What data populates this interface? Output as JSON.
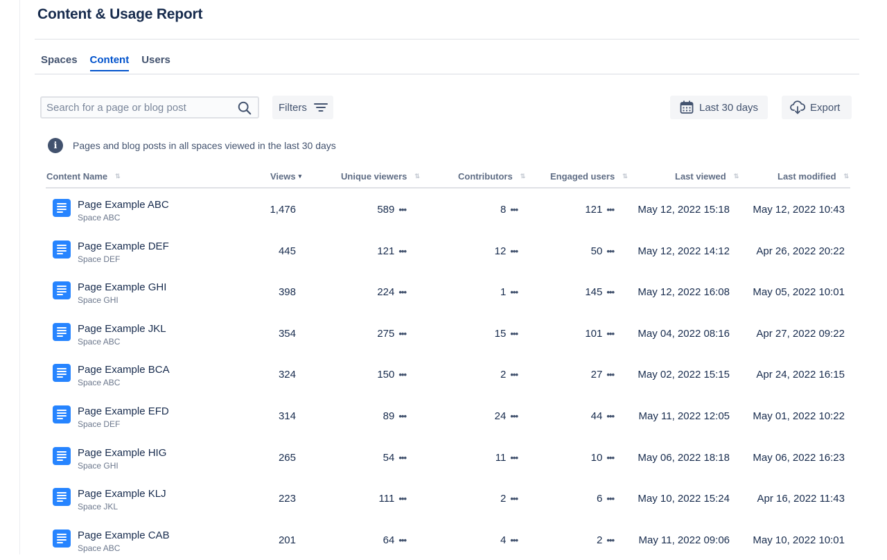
{
  "header": {
    "title": "Content & Usage Report"
  },
  "tabs": [
    {
      "label": "Spaces",
      "active": false
    },
    {
      "label": "Content",
      "active": true
    },
    {
      "label": "Users",
      "active": false
    }
  ],
  "toolbar": {
    "search_placeholder": "Search for a page or blog post",
    "search_value": "",
    "filters_label": "Filters",
    "date_range_label": "Last 30 days",
    "export_label": "Export"
  },
  "info": {
    "text": "Pages and blog posts in all spaces viewed in the last 30 days"
  },
  "table": {
    "columns": [
      {
        "label": "Content Name",
        "sorted": false
      },
      {
        "label": "Views",
        "sorted": true,
        "direction": "descending"
      },
      {
        "label": "Unique viewers",
        "sorted": false
      },
      {
        "label": "Contributors",
        "sorted": false
      },
      {
        "label": "Engaged users",
        "sorted": false
      },
      {
        "label": "Last viewed",
        "sorted": false
      },
      {
        "label": "Last modified",
        "sorted": false
      }
    ],
    "rows": [
      {
        "name": "Page Example ABC",
        "space": "Space ABC",
        "views": "1,476",
        "unique_viewers": "589",
        "contributors": "8",
        "engaged_users": "121",
        "last_viewed": "May 12, 2022 15:18",
        "last_modified": "May 12, 2022 10:43"
      },
      {
        "name": "Page Example DEF",
        "space": "Space DEF",
        "views": "445",
        "unique_viewers": "121",
        "contributors": "12",
        "engaged_users": "50",
        "last_viewed": "May 12, 2022 14:12",
        "last_modified": "Apr 26, 2022 20:22"
      },
      {
        "name": "Page Example GHI",
        "space": "Space GHI",
        "views": "398",
        "unique_viewers": "224",
        "contributors": "1",
        "engaged_users": "145",
        "last_viewed": "May 12, 2022 16:08",
        "last_modified": "May 05, 2022 10:01"
      },
      {
        "name": "Page Example JKL",
        "space": "Space ABC",
        "views": "354",
        "unique_viewers": "275",
        "contributors": "15",
        "engaged_users": "101",
        "last_viewed": "May 04, 2022 08:16",
        "last_modified": "Apr 27, 2022 09:22"
      },
      {
        "name": "Page Example BCA",
        "space": "Space ABC",
        "views": "324",
        "unique_viewers": "150",
        "contributors": "2",
        "engaged_users": "27",
        "last_viewed": "May 02, 2022 15:15",
        "last_modified": "Apr 24, 2022 16:15"
      },
      {
        "name": "Page Example EFD",
        "space": "Space DEF",
        "views": "314",
        "unique_viewers": "89",
        "contributors": "24",
        "engaged_users": "44",
        "last_viewed": "May 11, 2022 12:05",
        "last_modified": "May 01, 2022 10:22"
      },
      {
        "name": "Page Example HIG",
        "space": "Space GHI",
        "views": "265",
        "unique_viewers": "54",
        "contributors": "11",
        "engaged_users": "10",
        "last_viewed": "May 06, 2022 18:18",
        "last_modified": "May 06, 2022 16:23"
      },
      {
        "name": "Page Example KLJ",
        "space": "Space JKL",
        "views": "223",
        "unique_viewers": "111",
        "contributors": "2",
        "engaged_users": "6",
        "last_viewed": "May 10, 2022 15:24",
        "last_modified": "Apr 16, 2022 11:43"
      },
      {
        "name": "Page Example CAB",
        "space": "Space ABC",
        "views": "201",
        "unique_viewers": "64",
        "contributors": "4",
        "engaged_users": "2",
        "last_viewed": "May 11, 2022 09:06",
        "last_modified": "May 10, 2022 10:01"
      }
    ]
  },
  "icons": {
    "search": "search-icon",
    "filters": "filter-lines-icon",
    "calendar": "calendar-icon",
    "export": "cloud-download-icon",
    "info": "info-icon",
    "page": "page-document-icon",
    "more": "more-horizontal-icon",
    "sort": "sort-arrows-icon"
  },
  "colors": {
    "accent": "#0052cc",
    "text": "#172b4d",
    "subtle": "#42526e",
    "page_icon": "#2684ff"
  }
}
